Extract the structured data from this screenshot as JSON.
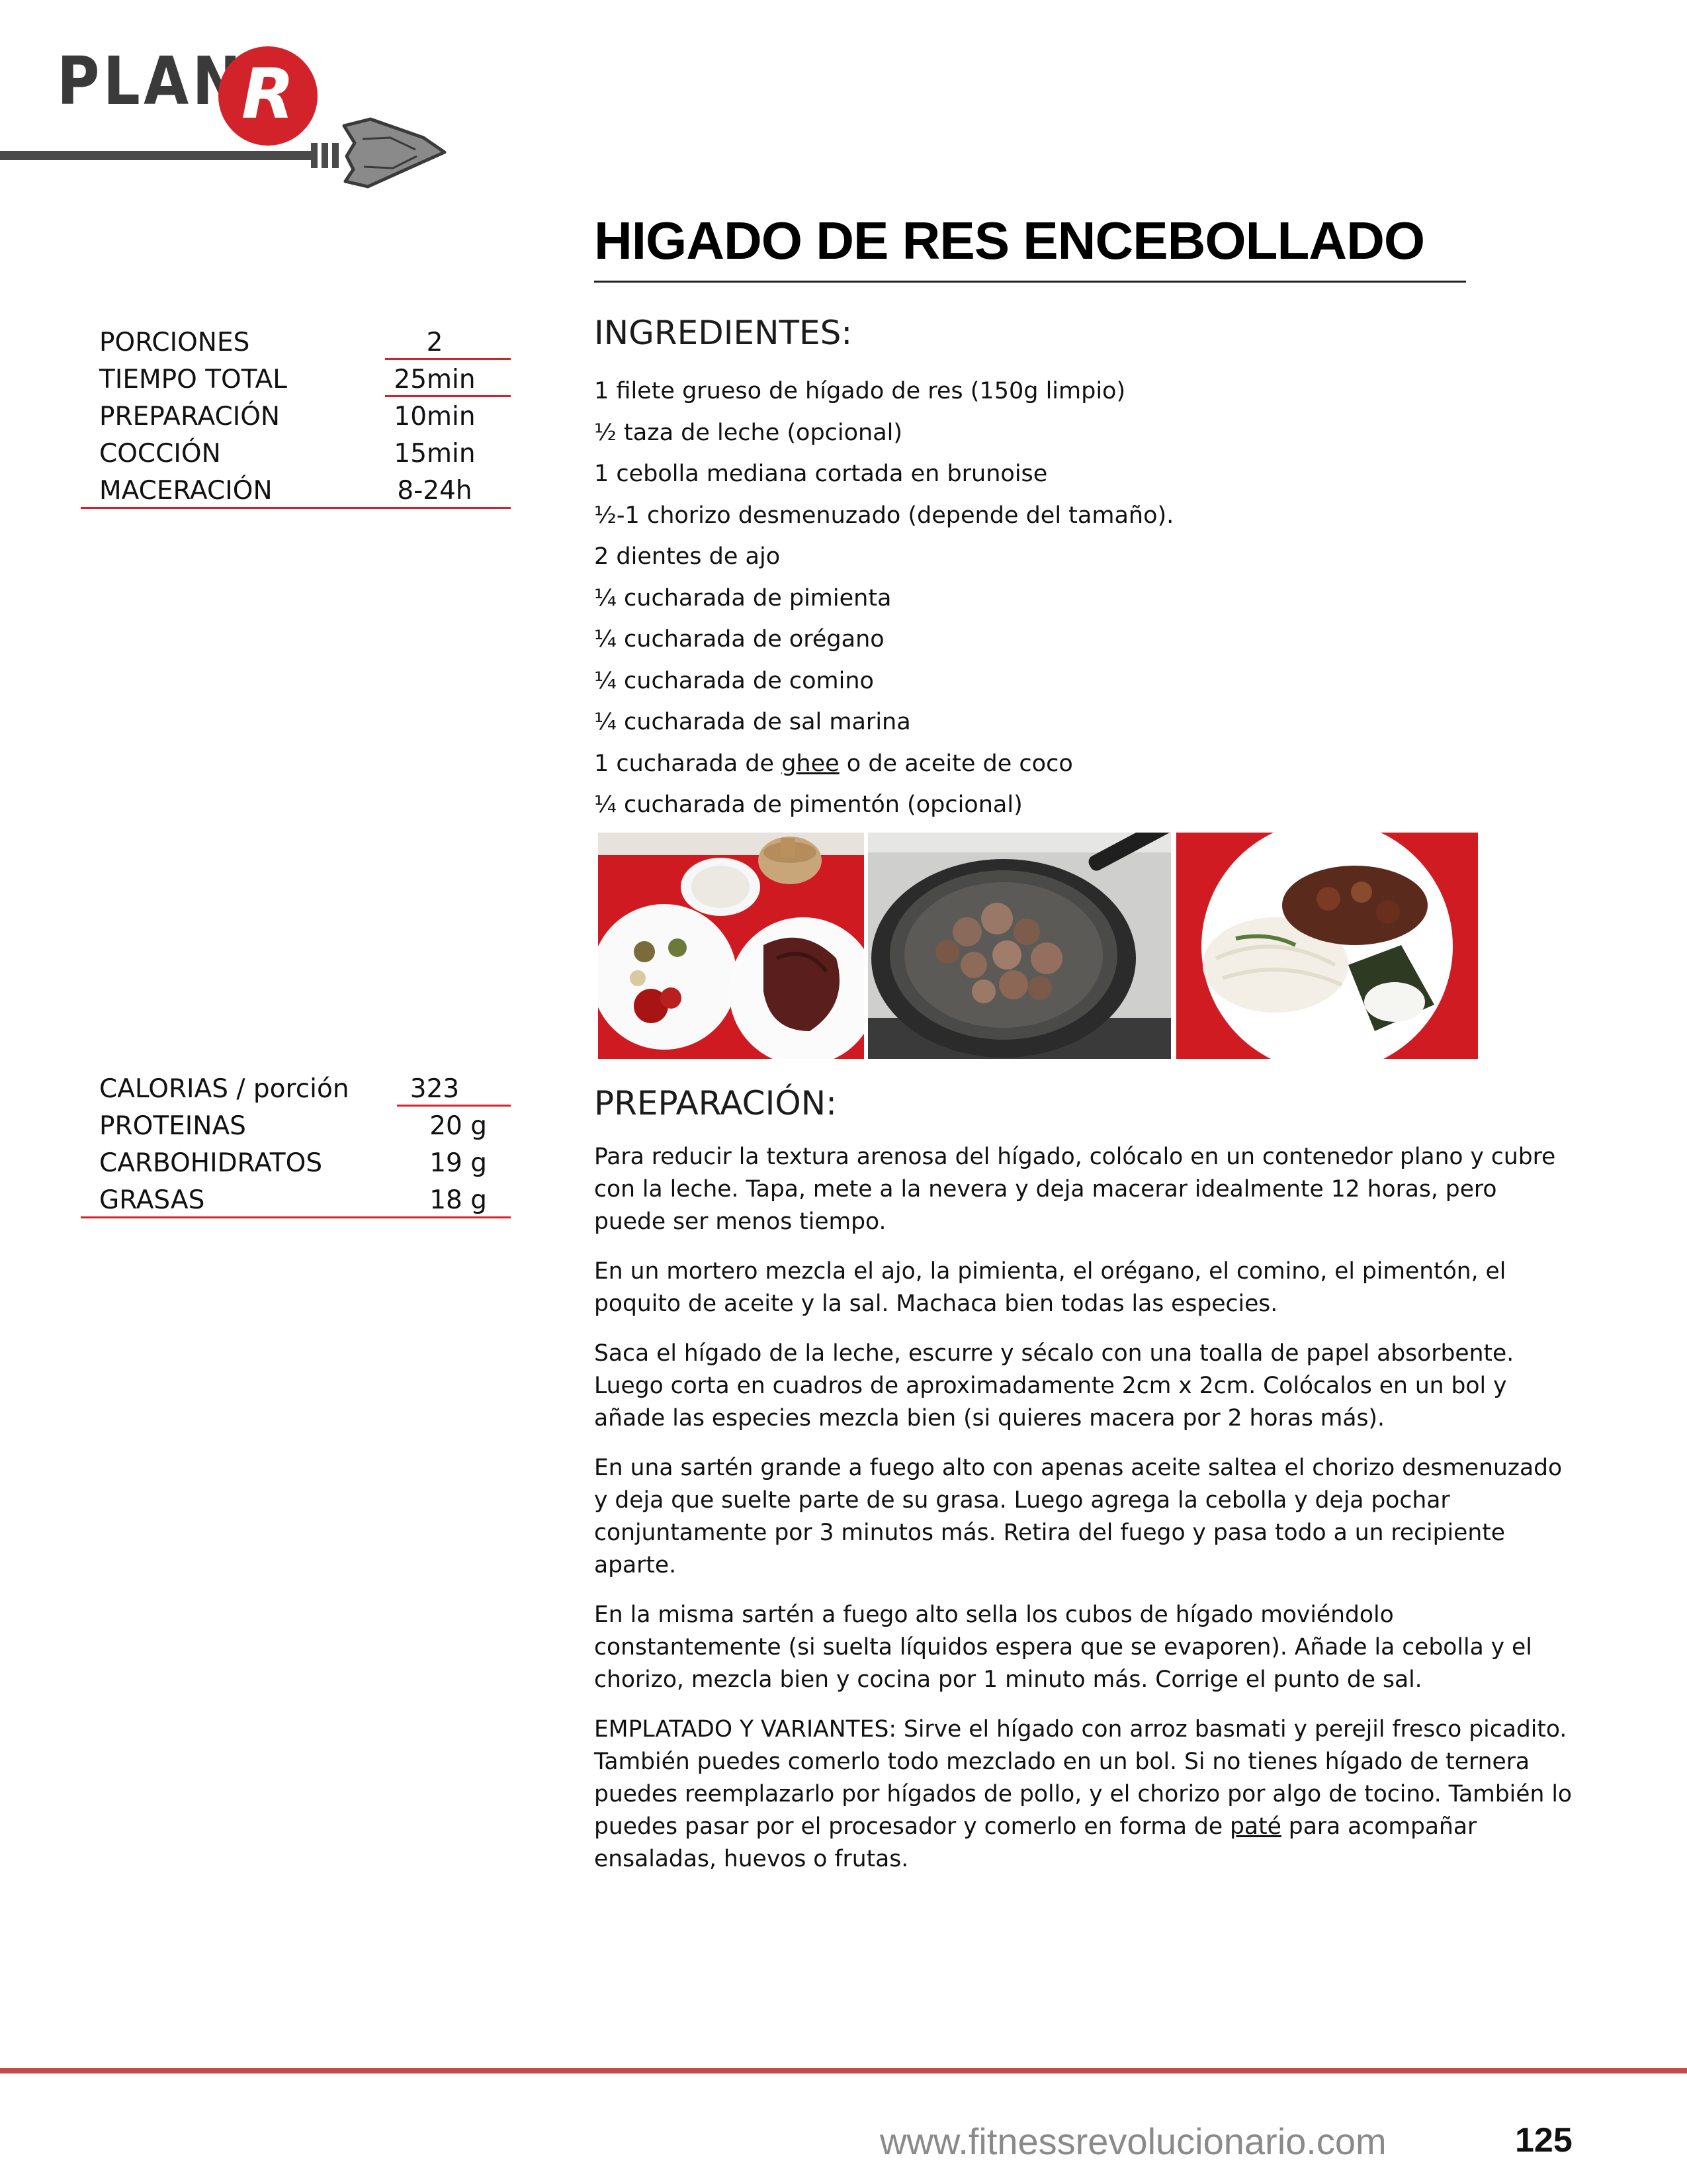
{
  "header": {
    "logo_word": "PLAN",
    "logo_letter": "R"
  },
  "recipe": {
    "title": "HIGADO DE RES ENCEBOLLADO"
  },
  "time_table": [
    {
      "label": "PORCIONES",
      "value": "2"
    },
    {
      "label": "TIEMPO TOTAL",
      "value": "25min"
    },
    {
      "label": "PREPARACIÓN",
      "value": "10min"
    },
    {
      "label": "COCCIÓN",
      "value": "15min"
    },
    {
      "label": "MACERACIÓN",
      "value": "8-24h"
    }
  ],
  "nutrition_table": [
    {
      "label": "CALORIAS / porción",
      "value": "323"
    },
    {
      "label": "PROTEINAS",
      "value": "20 g"
    },
    {
      "label": "CARBOHIDRATOS",
      "value": "19 g"
    },
    {
      "label": "GRASAS",
      "value": "18 g"
    }
  ],
  "ingredients": {
    "heading": "INGREDIENTES:",
    "items": [
      "1 filete grueso de hígado de res (150g limpio)",
      "½ taza de leche (opcional)",
      "1 cebolla mediana cortada en brunoise",
      "½-1 chorizo desmenuzado (depende del tamaño).",
      "2 dientes de ajo",
      "¼ cucharada de pimienta",
      "¼ cucharada de orégano",
      "¼ cucharada de comino",
      "¼ cucharada de sal marina",
      "1 cucharada de ghee o de aceite de coco",
      "¼ cucharada de pimentón (opcional)"
    ],
    "item9_parts": [
      "1 cucharada de ",
      "ghee",
      " o de aceite de coco"
    ]
  },
  "preparation": {
    "heading": "PREPARACIÓN:",
    "paragraphs": [
      "Para reducir la textura arenosa del hígado, colócalo en un contenedor plano y cubre con la leche. Tapa, mete a la nevera y deja macerar idealmente 12 horas, pero puede ser menos tiempo.",
      "En un mortero mezcla el ajo, la pimienta, el orégano, el comino, el pimentón, el poquito de aceite y la sal. Machaca bien todas las especies.",
      "Saca el hígado de la leche, escurre y sécalo con una toalla de papel absorbente. Luego corta en cuadros de aproximadamente 2cm x 2cm. Colócalos en un bol y añade las especies mezcla bien (si quieres macera por 2 horas más).",
      "En una sartén grande a fuego alto con apenas aceite saltea el chorizo desmenuzado y deja que suelte parte de su grasa. Luego agrega la cebolla y deja pochar conjuntamente por 3 minutos más. Retira del fuego y pasa todo a un recipiente aparte.",
      "En la misma sartén a fuego alto sella los cubos de hígado moviéndolo constantemente (si suelta líquidos espera que se evaporen). Añade la cebolla y el chorizo, mezcla bien y cocina por 1 minuto más. Corrige el punto de sal."
    ],
    "final_parts": [
      "EMPLATADO Y VARIANTES: Sirve el hígado con arroz basmati  y perejil fresco picadito.  También puedes comerlo todo mezclado en un bol. Si no tienes hígado de ternera puedes reemplazarlo por hígados de pollo, y el chorizo por algo de tocino. También lo puedes pasar por el procesador y comerlo en forma de ",
      "paté",
      " para acompañar ensaladas, huevos o frutas."
    ]
  },
  "footer": {
    "url": "www.fitnessrevolucionario.com",
    "page_number": "125"
  },
  "colors": {
    "accent_red": "#d2232a",
    "footer_rule": "#c9484b",
    "logo_gray": "#3a3a3a"
  }
}
